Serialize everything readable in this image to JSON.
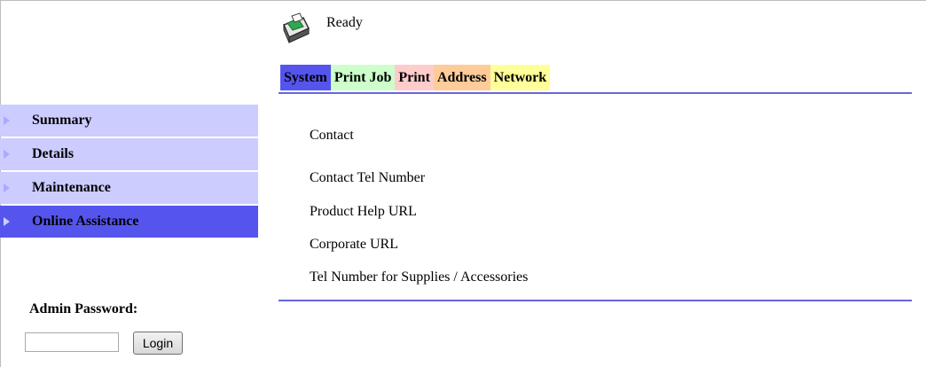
{
  "status": {
    "text": "Ready",
    "icon": "printer-icon"
  },
  "tabs": [
    {
      "label": "System"
    },
    {
      "label": "Print Job"
    },
    {
      "label": "Print"
    },
    {
      "label": "Address"
    },
    {
      "label": "Network"
    }
  ],
  "sidebar": {
    "items": [
      {
        "label": "Summary"
      },
      {
        "label": "Details"
      },
      {
        "label": "Maintenance"
      },
      {
        "label": "Online Assistance"
      }
    ],
    "active_index": 3
  },
  "admin": {
    "label": "Admin Password:",
    "password_value": "",
    "login_label": "Login"
  },
  "content": {
    "rows": [
      {
        "label": "Contact"
      },
      {
        "label": "Contact Tel Number"
      },
      {
        "label": "Product Help URL"
      },
      {
        "label": "Corporate URL"
      },
      {
        "label": "Tel Number for Supplies / Accessories"
      }
    ]
  },
  "colors": {
    "active_tab": "#5555ee",
    "sidebar_item": "#ccccff",
    "sidebar_active": "#5555ee",
    "rule": "#6666dd"
  }
}
